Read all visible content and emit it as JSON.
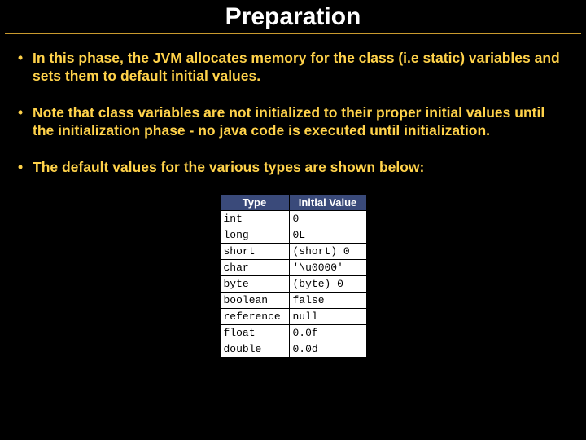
{
  "title": "Preparation",
  "bullets": [
    {
      "pre": "In this phase, the JVM allocates memory for the class (i.e ",
      "u": "static",
      "post": ") variables and sets them to default initial values."
    },
    {
      "pre": "Note that class variables are not initialized to their proper initial values until the initialization phase - no java code is executed until initialization.",
      "u": "",
      "post": ""
    },
    {
      "pre": "The default values for the various types are shown below:",
      "u": "",
      "post": ""
    }
  ],
  "table": {
    "headers": {
      "type": "Type",
      "value": "Initial Value"
    },
    "rows": [
      {
        "type": "int",
        "value": "0"
      },
      {
        "type": "long",
        "value": "0L"
      },
      {
        "type": "short",
        "value": "(short) 0"
      },
      {
        "type": "char",
        "value": "'\\u0000'"
      },
      {
        "type": "byte",
        "value": "(byte) 0"
      },
      {
        "type": "boolean",
        "value": "false"
      },
      {
        "type": "reference",
        "value": "null"
      },
      {
        "type": "float",
        "value": "0.0f"
      },
      {
        "type": "double",
        "value": "0.0d"
      }
    ]
  }
}
